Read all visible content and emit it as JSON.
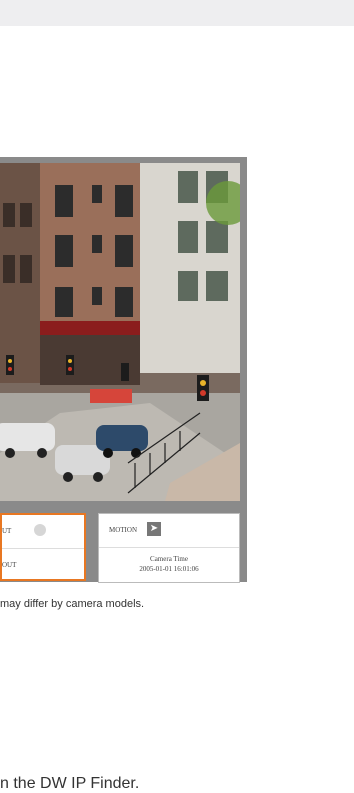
{
  "io_panel": {
    "alarm_in_label": "UT",
    "alarm_out_label": "OUT"
  },
  "motion_panel": {
    "label": "MOTION",
    "icon": "running-person-icon"
  },
  "camera_time": {
    "label": "Camera Time",
    "value": "2005-01-01 16:01:06"
  },
  "caption": "may differ by camera models.",
  "bottom_text": "n the DW IP Finder.",
  "colors": {
    "highlight_border": "#e87722",
    "frame_gray": "#8a8a8a",
    "topbar": "#eeeef0"
  }
}
